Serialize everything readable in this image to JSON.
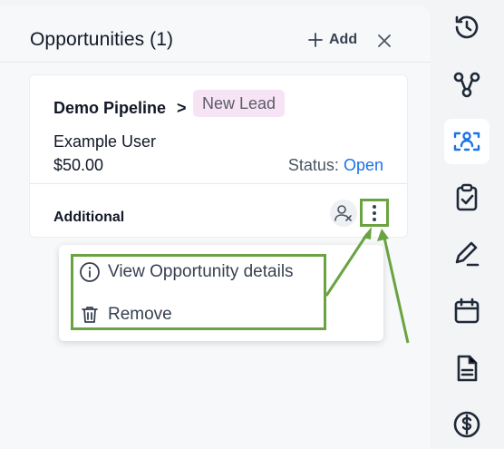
{
  "panel": {
    "title": "Opportunities (1)",
    "add_label": "Add",
    "close_icon": "close-icon"
  },
  "opportunity": {
    "pipeline": "Demo Pipeline",
    "separator": ">",
    "stage": "New Lead",
    "contact": "Example User",
    "amount": "$50.00",
    "status_label": "Status:",
    "status_value": "Open",
    "additional_label": "Additional"
  },
  "menu": {
    "items": [
      {
        "label": "View Opportunity details",
        "icon": "info-icon"
      },
      {
        "label": "Remove",
        "icon": "trash-icon"
      }
    ]
  },
  "rail": {
    "icons": [
      "activity-clock-icon",
      "workflow-icon",
      "opportunities-icon",
      "tasks-clipboard-icon",
      "notes-pen-icon",
      "calendar-icon",
      "documents-icon",
      "payments-dollar-icon"
    ],
    "active": "opportunities-icon"
  },
  "colors": {
    "highlight": "#6aa341",
    "link": "#1a73e8",
    "badge_bg": "#f6e4f5",
    "active_icon": "#1a73e8"
  }
}
